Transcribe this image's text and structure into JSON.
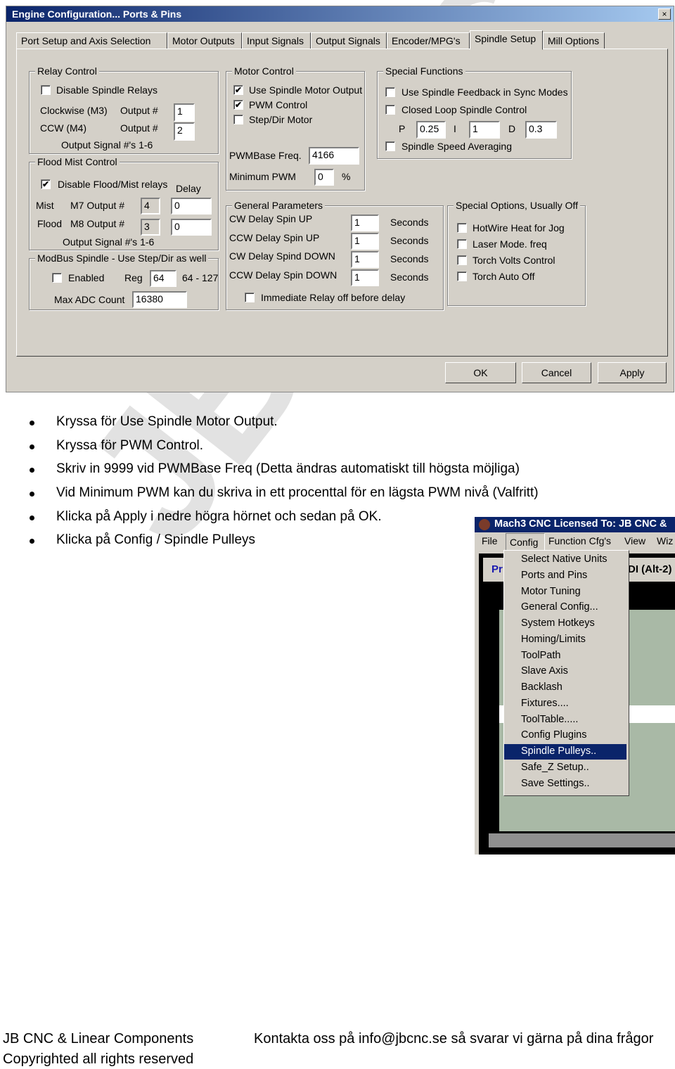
{
  "watermark": "JB CNC",
  "dialog": {
    "title": "Engine Configuration... Ports & Pins",
    "close": "×",
    "tabs": [
      "Port Setup and Axis Selection",
      "Motor Outputs",
      "Input Signals",
      "Output Signals",
      "Encoder/MPG's",
      "Spindle Setup",
      "Mill Options"
    ],
    "active_tab": "Spindle Setup",
    "relay": {
      "title": "Relay Control",
      "disable": "Disable Spindle Relays",
      "disable_checked": false,
      "cw": "Clockwise (M3)",
      "ccw": "CCW (M4)",
      "output": "Output #",
      "cw_val": "1",
      "ccw_val": "2",
      "note": "Output Signal #'s 1-6"
    },
    "flood": {
      "title": "Flood Mist Control",
      "disable": "Disable Flood/Mist relays",
      "disable_checked": true,
      "delay": "Delay",
      "mist": "Mist",
      "flood": "Flood",
      "m7": "M7 Output #",
      "m8": "M8 Output #",
      "mist_out": "4",
      "mist_delay": "0",
      "flood_out": "3",
      "flood_delay": "0",
      "note": "Output Signal #'s 1-6"
    },
    "modbus": {
      "title": "ModBus Spindle - Use Step/Dir as well",
      "enabled": "Enabled",
      "enabled_checked": false,
      "reg": "Reg",
      "reg_val": "64",
      "range": "64 - 127",
      "max_adc": "Max ADC Count",
      "max_adc_val": "16380"
    },
    "motor": {
      "title": "Motor Control",
      "use_spindle": "Use Spindle Motor Output",
      "use_spindle_checked": true,
      "pwm": "PWM Control",
      "pwm_checked": true,
      "stepdir": "Step/Dir Motor",
      "stepdir_checked": false,
      "pwm_base": "PWMBase Freq.",
      "pwm_base_val": "4166",
      "min_pwm": "Minimum PWM",
      "min_pwm_val": "0",
      "percent": "%"
    },
    "special": {
      "title": "Special Functions",
      "feedback": "Use Spindle Feedback in Sync Modes",
      "closed_loop": "Closed Loop Spindle Control",
      "p": "P",
      "p_val": "0.25",
      "i": "I",
      "i_val": "1",
      "d": "D",
      "d_val": "0.3",
      "averaging": "Spindle Speed Averaging"
    },
    "general": {
      "title": "General Parameters",
      "rows": [
        {
          "label": "CW Delay Spin UP",
          "val": "1",
          "unit": "Seconds"
        },
        {
          "label": "CCW Delay Spin UP",
          "val": "1",
          "unit": "Seconds"
        },
        {
          "label": "CW Delay Spind DOWN",
          "val": "1",
          "unit": "Seconds"
        },
        {
          "label": "CCW Delay Spin DOWN",
          "val": "1",
          "unit": "Seconds"
        }
      ],
      "immediate": "Immediate Relay off before delay"
    },
    "options": {
      "title": "Special Options, Usually Off",
      "items": [
        "HotWire Heat for Jog",
        "Laser Mode. freq",
        "Torch Volts Control",
        "Torch Auto Off"
      ]
    },
    "buttons": {
      "ok": "OK",
      "cancel": "Cancel",
      "apply": "Apply"
    }
  },
  "bullets": [
    "Kryssa för Use Spindle Motor Output.",
    "Kryssa för PWM Control.",
    "Skriv in 9999 vid PWMBase Freq (Detta ändras automatiskt till högsta möjliga)",
    "Vid Minimum PWM kan du skriva in ett procenttal för en lägsta PWM nivå (Valfritt)",
    "Klicka på Apply i nedre högra hörnet och sedan på OK.",
    "Klicka på Config / Spindle Pulleys"
  ],
  "mach3": {
    "title": "Mach3 CNC  Licensed To: JB CNC &",
    "menu": [
      "File",
      "Config",
      "Function Cfg's",
      "View",
      "Wiz"
    ],
    "bg_left": "Pr",
    "bg_right": "DI (Alt-2)",
    "items": [
      "Select Native Units",
      "Ports and Pins",
      "Motor Tuning",
      "General Config...",
      "System Hotkeys",
      "Homing/Limits",
      "ToolPath",
      "Slave Axis",
      "Backlash",
      "Fixtures....",
      "ToolTable.....",
      "Config Plugins",
      "Spindle Pulleys..",
      "Safe_Z Setup..",
      "Save Settings.."
    ],
    "selected": "Spindle Pulleys.."
  },
  "footer": {
    "company": "JB CNC & Linear Components",
    "copyright": "Copyrighted all rights reserved",
    "contact": "Kontakta oss på info@jbcnc.se så svarar vi gärna på dina frågor"
  },
  "colors": {
    "titlebar": "#0a246a",
    "dialog_bg": "#d4d0c8",
    "menu_highlight": "#0a246a",
    "watermark": "#e2e2e2"
  }
}
